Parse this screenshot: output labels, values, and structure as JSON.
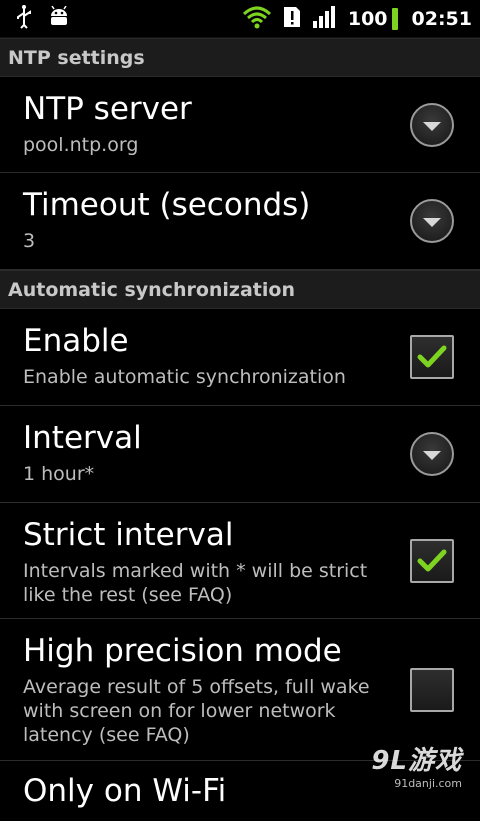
{
  "status_bar": {
    "icons": [
      "usb-icon",
      "android-debug-icon",
      "wifi-icon",
      "alert-icon",
      "signal-icon"
    ],
    "battery_level": "100",
    "time": "02:51"
  },
  "sections": [
    {
      "header": "NTP settings",
      "items": [
        {
          "title": "NTP server",
          "summary": "pool.ntp.org",
          "widget": "dropdown"
        },
        {
          "title": "Timeout (seconds)",
          "summary": "3",
          "widget": "dropdown"
        }
      ]
    },
    {
      "header": "Automatic synchronization",
      "items": [
        {
          "title": "Enable",
          "summary": "Enable automatic synchronization",
          "widget": "checkbox",
          "checked": true
        },
        {
          "title": "Interval",
          "summary": "1 hour*",
          "widget": "dropdown"
        },
        {
          "title": "Strict interval",
          "summary": "Intervals marked with * will be strict like the rest (see FAQ)",
          "widget": "checkbox",
          "checked": true
        },
        {
          "title": "High precision mode",
          "summary": "Average result of 5 offsets, full wake with screen on for lower network latency (see FAQ)",
          "widget": "checkbox",
          "checked": false
        },
        {
          "title": "Only on Wi-Fi",
          "summary": "",
          "widget": "checkbox",
          "checked": false
        }
      ]
    }
  ],
  "watermark": {
    "logo": "9L游戏",
    "url": "91danji.com"
  },
  "colors": {
    "check_green": "#7ed321",
    "category_bg": "#1c1c1c"
  }
}
